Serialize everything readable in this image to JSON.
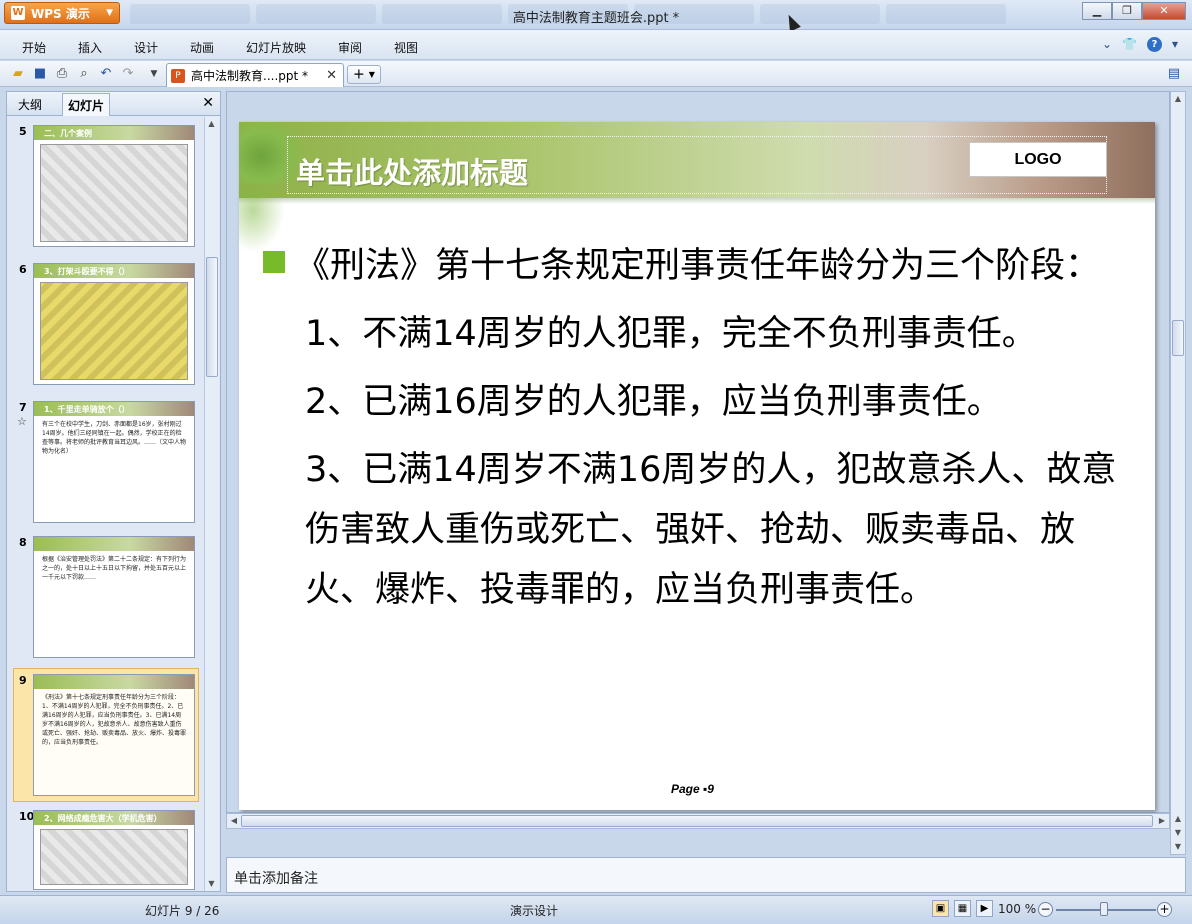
{
  "app": {
    "name": "WPS 演示",
    "window_title": "高中法制教育主题班会.ppt *"
  },
  "menu": [
    "开始",
    "插入",
    "设计",
    "动画",
    "幻灯片放映",
    "审阅",
    "视图"
  ],
  "doc_tab": {
    "label": "高中法制教育....ppt *"
  },
  "left_panel": {
    "tabs": [
      "大纲",
      "幻灯片"
    ],
    "active_tab": "幻灯片",
    "thumbnails": [
      {
        "number": "5",
        "title": "二、几个案例",
        "kind": "cartoon"
      },
      {
        "number": "6",
        "title": "3、打架斗殴要不得（）",
        "kind": "cartoon"
      },
      {
        "number": "7",
        "title": "1、千里走单骑放个（）",
        "kind": "text",
        "star": "☆",
        "body": "有三个在校中学生，刀剑、赤面都是16岁，张村刚过14周岁。他们三经同镇在一起。偶然，学校正在的检查等事。将老师的批评教育当耳边风。……（文中人物物为化名）"
      },
      {
        "number": "8",
        "title": "",
        "kind": "text",
        "body": "根据《治安管理处罚法》第二十二条规定：有下列行为之一的，处十日以上十五日以下拘留，并处五百元以上一千元以下罚款……"
      },
      {
        "number": "9",
        "title": "",
        "kind": "text",
        "selected": true,
        "body": "《刑法》第十七条规定刑事责任年龄分为三个阶段：1、不满14周岁的人犯罪，完全不负刑事责任。2、已满16周岁的人犯罪，应当负刑事责任。3、已满14周岁不满16周岁的人，犯故意杀人、故意伤害致人重伤或死亡、强奸、抢劫、贩卖毒品、放火、爆炸、投毒罪的，应当负刑事责任。"
      },
      {
        "number": "10",
        "title": "2、网络成瘾危害大（学机危害）",
        "kind": "cartoon"
      }
    ]
  },
  "slide": {
    "title_placeholder": "单击此处添加标题",
    "logo": "LOGO",
    "lines": [
      "《刑法》第十七条规定刑事责任年龄分为三个阶段：",
      "1、不满14周岁的人犯罪，完全不负刑事责任。",
      "2、已满16周岁的人犯罪，应当负刑事责任。",
      "3、已满14周岁不满16周岁的人，犯故意杀人、故意伤害致人重伤或死亡、强奸、抢劫、贩卖毒品、放火、爆炸、投毒罪的，应当负刑事责任。"
    ],
    "page_label": "Page ▪9"
  },
  "notes": {
    "placeholder": "单击添加备注"
  },
  "status": {
    "slide_position": "幻灯片 9 / 26",
    "design": "演示设计",
    "zoom": "100 %"
  },
  "colors": {
    "bullet": "#77bb2b",
    "header_green": "#8fb048",
    "wps_orange": "#e0701a"
  }
}
